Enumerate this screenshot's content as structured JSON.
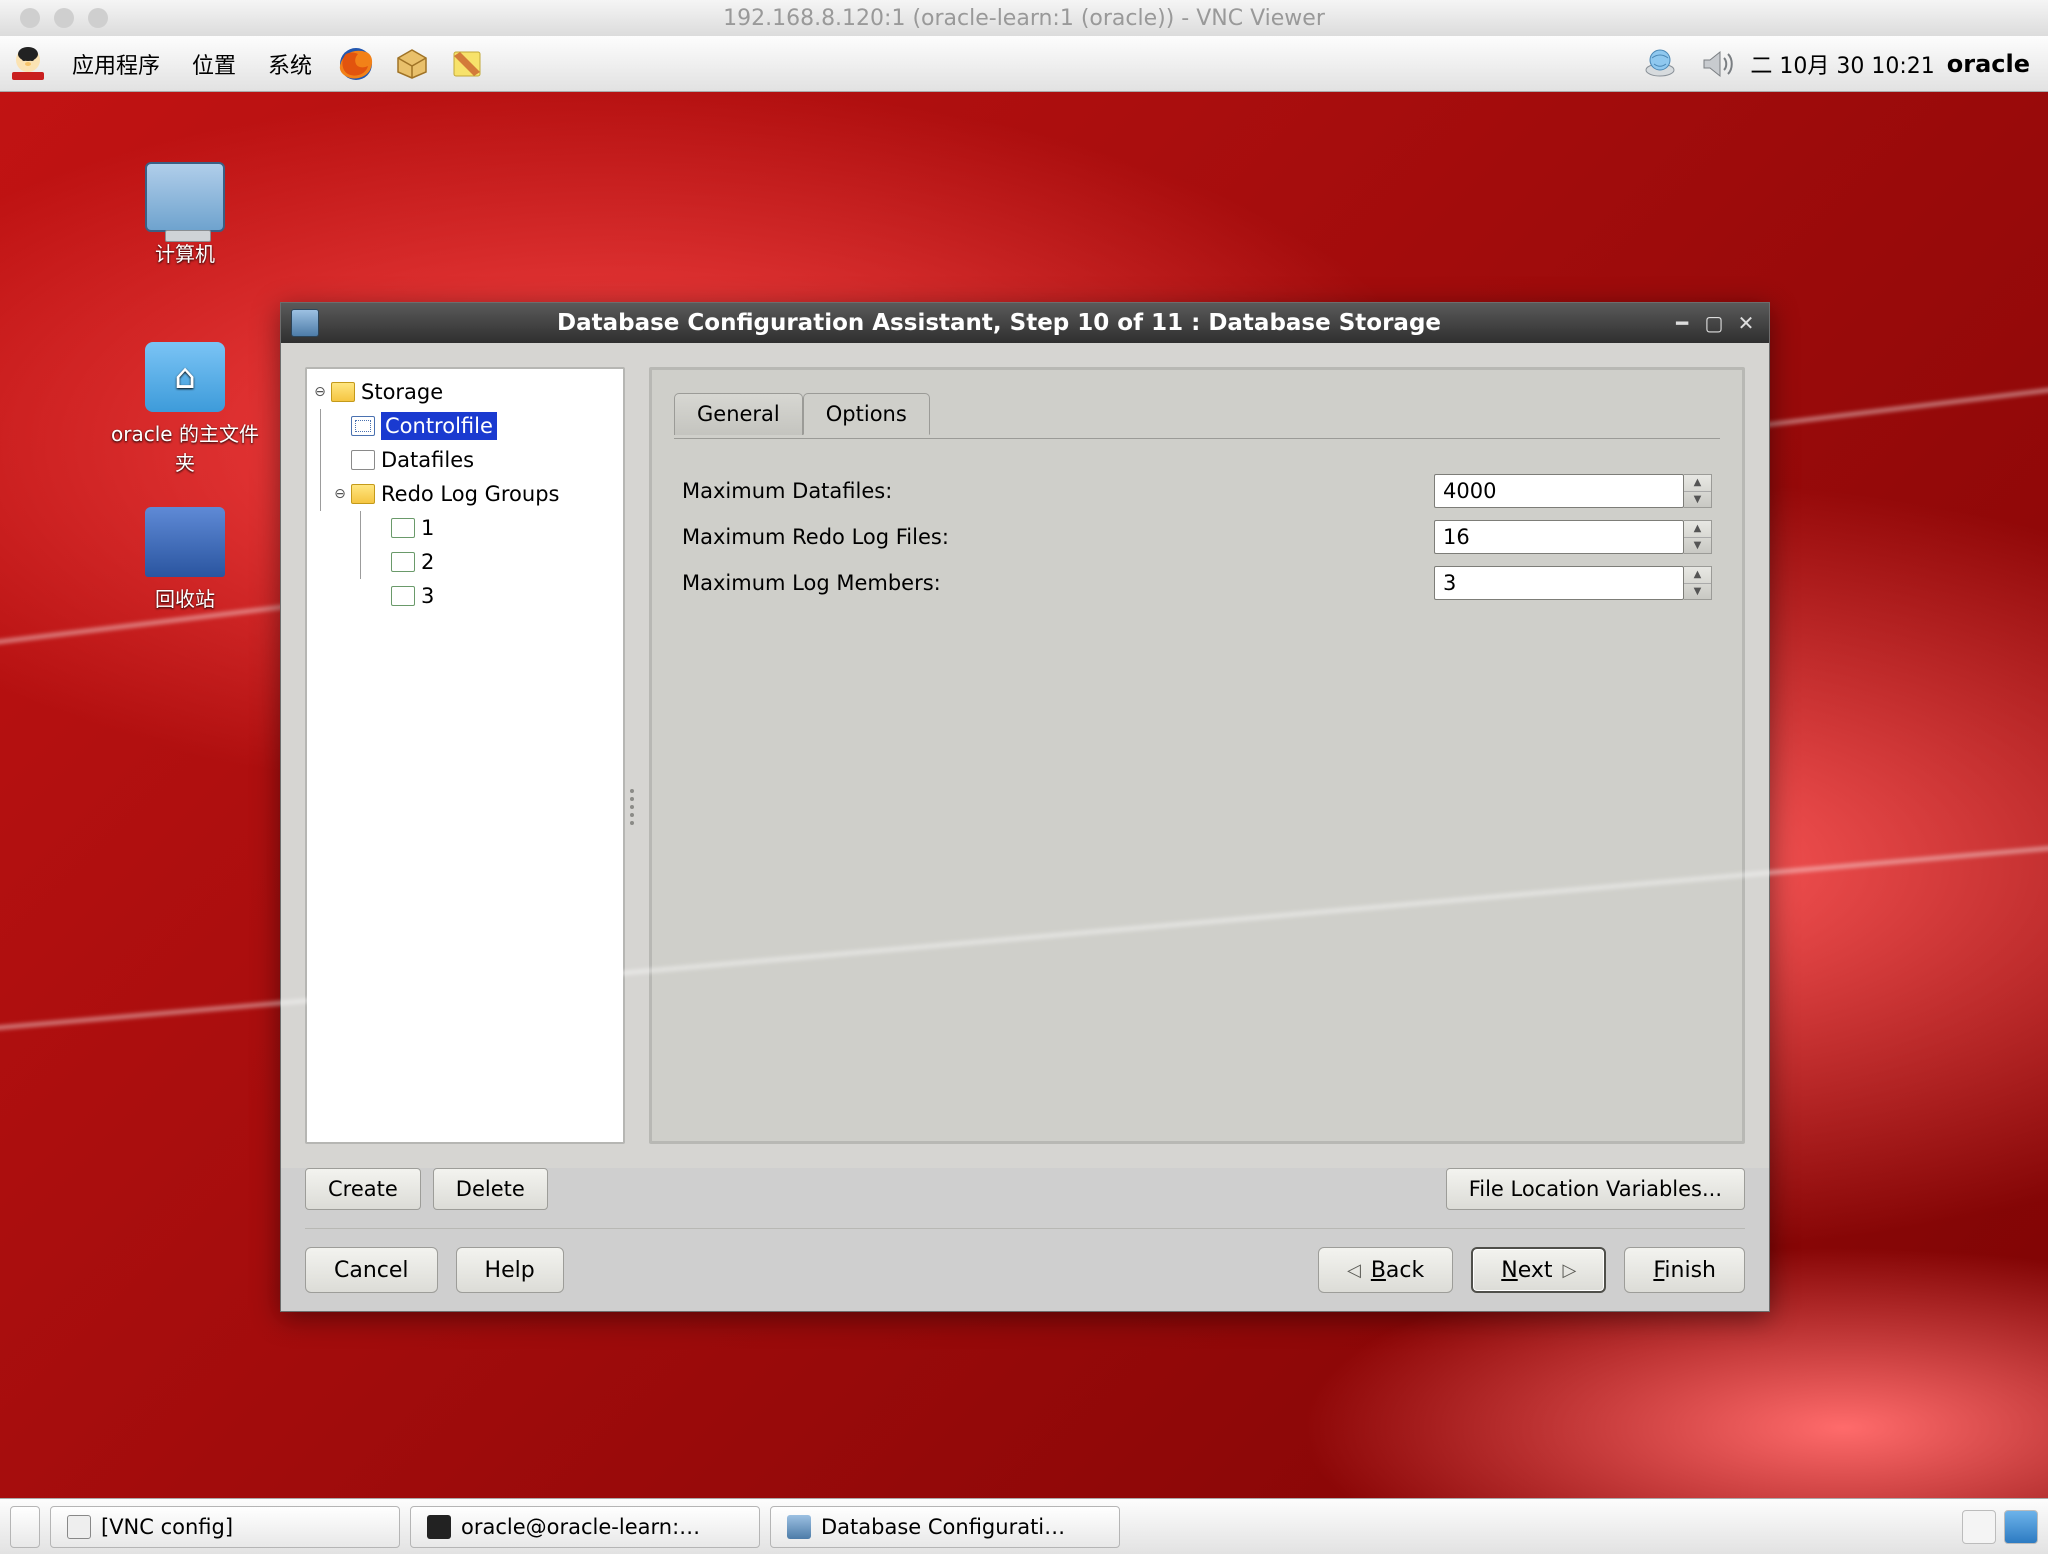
{
  "mac_title": "192.168.8.120:1 (oracle-learn:1 (oracle)) - VNC Viewer",
  "panel": {
    "apps": "应用程序",
    "places": "位置",
    "system": "系统",
    "clock": "二  10月 30 10:21",
    "user": "oracle"
  },
  "desk": {
    "computer": "计算机",
    "home": "oracle 的主文件夹",
    "trash": "回收站"
  },
  "dbca": {
    "title": "Database Configuration Assistant, Step 10 of 11 : Database Storage",
    "tree": {
      "storage": "Storage",
      "controlfile": "Controlfile",
      "datafiles": "Datafiles",
      "redo": "Redo Log Groups",
      "g1": "1",
      "g2": "2",
      "g3": "3"
    },
    "tabs": {
      "general": "General",
      "options": "Options"
    },
    "form": {
      "max_datafiles_lbl": "Maximum Datafiles:",
      "max_datafiles_val": "4000",
      "max_redo_lbl": "Maximum Redo Log Files:",
      "max_redo_val": "16",
      "max_members_lbl": "Maximum Log Members:",
      "max_members_val": "3"
    },
    "btns": {
      "create": "Create",
      "delete": "Delete",
      "filevars": "File Location Variables...",
      "cancel": "Cancel",
      "help": "Help",
      "back": "Back",
      "next": "Next",
      "finish": "Finish"
    }
  },
  "taskbar": {
    "vnc": "[VNC config]",
    "term": "oracle@oracle-learn:…",
    "dbca": "Database Configurati…"
  }
}
